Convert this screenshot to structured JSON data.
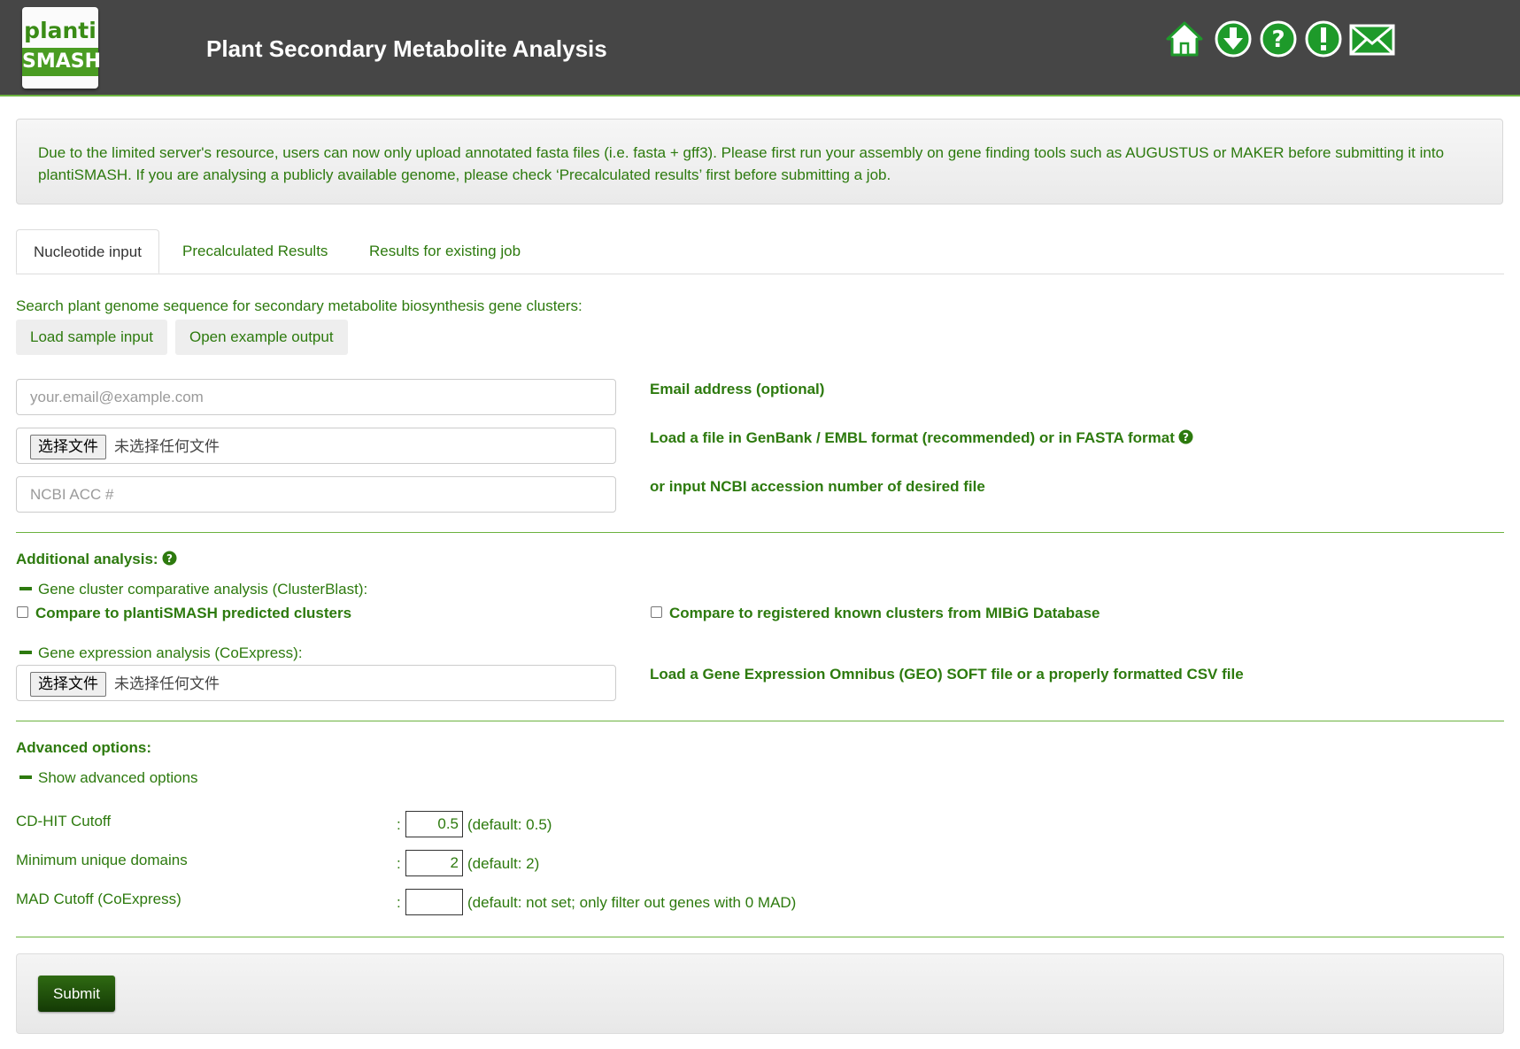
{
  "header": {
    "logo_line1": "planti",
    "logo_line2": "SMASH",
    "title": "Plant Secondary Metabolite Analysis",
    "icons": [
      "home-icon",
      "download-icon",
      "help-icon",
      "about-icon",
      "contact-icon"
    ]
  },
  "notice": {
    "text": "Due to the limited server's resource, users can now only upload annotated fasta files (i.e. fasta + gff3). Please first run your assembly on gene finding tools such as AUGUSTUS or MAKER before submitting it into plantiSMASH. If you are analysing a publicly available genome, please check ‘Precalculated results’ first before submitting a job."
  },
  "tabs": [
    {
      "label": "Nucleotide input",
      "active": true
    },
    {
      "label": "Precalculated Results",
      "active": false
    },
    {
      "label": "Results for existing job",
      "active": false
    }
  ],
  "search": {
    "intro": "Search plant genome sequence for secondary metabolite biosynthesis gene clusters:",
    "load_sample": "Load sample input",
    "open_example": "Open example output"
  },
  "inputs": {
    "email_placeholder": "your.email@example.com",
    "email_label": "Email address (optional)",
    "file_button": "选择文件",
    "file_none": "未选择任何文件",
    "file_label": "Load a file in GenBank / EMBL format (recommended) or in FASTA format",
    "ncbi_placeholder": "NCBI ACC #",
    "ncbi_label": "or input NCBI accession number of desired file"
  },
  "additional": {
    "heading": "Additional analysis:",
    "clusterblast_toggle": "Gene cluster comparative analysis (ClusterBlast):",
    "compare_planti": "Compare to plantiSMASH predicted clusters",
    "compare_mibig": "Compare to registered known clusters from MIBiG Database",
    "coexpress_toggle": "Gene expression analysis (CoExpress):",
    "geo_file_button": "选择文件",
    "geo_file_none": "未选择任何文件",
    "geo_label": "Load a Gene Expression Omnibus (GEO) SOFT file or a properly formatted CSV file"
  },
  "advanced": {
    "heading": "Advanced options:",
    "toggle": "Show advanced options",
    "colon": ":",
    "options": [
      {
        "label": "CD-HIT Cutoff",
        "value": "0.5",
        "hint": "(default: 0.5)"
      },
      {
        "label": "Minimum unique domains",
        "value": "2",
        "hint": "(default: 2)"
      },
      {
        "label": "MAD Cutoff (CoExpress)",
        "value": "",
        "hint": "(default: not set; only filter out genes with 0 MAD)"
      }
    ]
  },
  "submit_label": "Submit",
  "colors": {
    "header_bg": "#464646",
    "accent_green": "#2d7a0e",
    "icon_green": "#1e9a2a",
    "divider_green": "#6cb33f"
  }
}
